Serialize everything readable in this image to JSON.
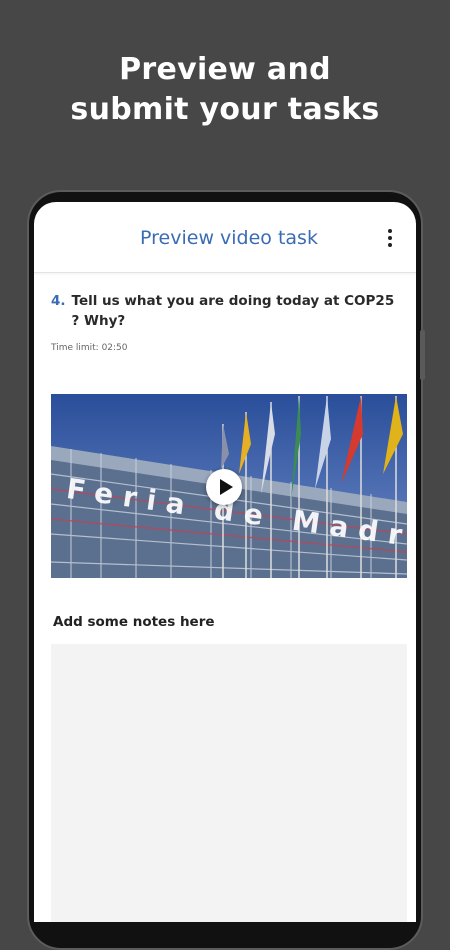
{
  "promo": {
    "headline_line1": "Preview and",
    "headline_line2": "submit your tasks"
  },
  "appbar": {
    "title": "Preview video task",
    "menu_icon": "more-vert-icon"
  },
  "task": {
    "number": "4.",
    "question": "Tell us what you are doing today at COP25 ? Why?",
    "time_limit": "Time limit: 02:50",
    "video_sign_text": "Feria de Madrid",
    "play_icon": "play-icon"
  },
  "notes": {
    "label": "Add some notes here",
    "placeholder": ""
  },
  "colors": {
    "background": "#474747",
    "accent": "#3a6cb5"
  }
}
